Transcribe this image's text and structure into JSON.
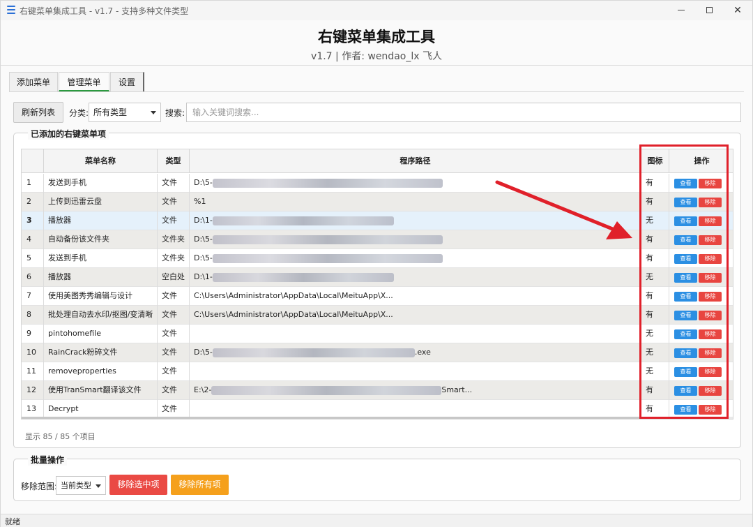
{
  "window": {
    "title": "右键菜单集成工具 - v1.7 - 支持多种文件类型"
  },
  "header": {
    "title": "右键菜单集成工具",
    "subtitle": "v1.7 | 作者: wendao_lx 飞人"
  },
  "tabs": [
    {
      "label": "添加菜单",
      "active": false
    },
    {
      "label": "管理菜单",
      "active": true
    },
    {
      "label": "设置",
      "active": false
    }
  ],
  "toolbar": {
    "refresh_label": "刷新列表",
    "category_label": "分类:",
    "category_value": "所有类型",
    "search_label": "搜索:",
    "search_placeholder": "输入关键词搜索..."
  },
  "list_group": {
    "title": "已添加的右键菜单项",
    "columns": [
      "菜单名称",
      "类型",
      "程序路径",
      "图标",
      "操作"
    ],
    "view_label": "查看",
    "remove_label": "移除",
    "rows": [
      {
        "index": "1",
        "name": "发送到手机",
        "type": "文件",
        "path": "D:\\5-",
        "path_blurred": true,
        "path_suffix": "",
        "icon": "有"
      },
      {
        "index": "2",
        "name": "上传到迅雷云盘",
        "type": "文件",
        "path": "%1",
        "path_blurred": false,
        "path_suffix": "",
        "icon": "有"
      },
      {
        "index": "3",
        "name": "播放器",
        "type": "文件",
        "path": "D:\\1-",
        "path_blurred": true,
        "path_suffix": "",
        "icon": "无"
      },
      {
        "index": "4",
        "name": "自动备份该文件夹",
        "type": "文件夹",
        "path": "D:\\5-",
        "path_blurred": true,
        "path_suffix": "",
        "icon": "有"
      },
      {
        "index": "5",
        "name": "发送到手机",
        "type": "文件夹",
        "path": "D:\\5-",
        "path_blurred": true,
        "path_suffix": "",
        "icon": "有"
      },
      {
        "index": "6",
        "name": "播放器",
        "type": "空白处",
        "path": "D:\\1-",
        "path_blurred": true,
        "path_suffix": "",
        "icon": "无"
      },
      {
        "index": "7",
        "name": "使用美图秀秀编辑与设计",
        "type": "文件",
        "path": "C:\\Users\\Administrator\\AppData\\Local\\MeituApp\\X...",
        "path_blurred": false,
        "path_suffix": "",
        "icon": "有"
      },
      {
        "index": "8",
        "name": "批处理自动去水印/抠图/变清晰",
        "type": "文件",
        "path": "C:\\Users\\Administrator\\AppData\\Local\\MeituApp\\X...",
        "path_blurred": false,
        "path_suffix": "",
        "icon": "有"
      },
      {
        "index": "9",
        "name": "pintohomefile",
        "type": "文件",
        "path": "",
        "path_blurred": false,
        "path_suffix": "",
        "icon": "无"
      },
      {
        "index": "10",
        "name": "RainCrack粉碎文件",
        "type": "文件",
        "path": "D:\\5-",
        "path_blurred": true,
        "path_suffix": ".exe",
        "icon": "无"
      },
      {
        "index": "11",
        "name": "removeproperties",
        "type": "文件",
        "path": "",
        "path_blurred": false,
        "path_suffix": "",
        "icon": "无"
      },
      {
        "index": "12",
        "name": "使用TranSmart翻译该文件",
        "type": "文件",
        "path": "E:\\2-",
        "path_blurred": true,
        "path_suffix": "Smart...",
        "icon": "有"
      },
      {
        "index": "13",
        "name": "Decrypt",
        "type": "文件",
        "path": "",
        "path_blurred": false,
        "path_suffix": "",
        "icon": "有"
      }
    ],
    "count_text": "显示 85 / 85 个项目"
  },
  "batch_group": {
    "title": "批量操作",
    "range_label": "移除范围:",
    "range_value": "当前类型",
    "remove_selected_label": "移除选中项",
    "remove_all_label": "移除所有项"
  },
  "statusbar": {
    "text": "就绪"
  },
  "colors": {
    "view_button": "#2b8fe3",
    "remove_button": "#e84540",
    "remove_all_button": "#f5a01c",
    "highlight": "#e0202a",
    "active_tab_underline": "#2b9a3f"
  }
}
